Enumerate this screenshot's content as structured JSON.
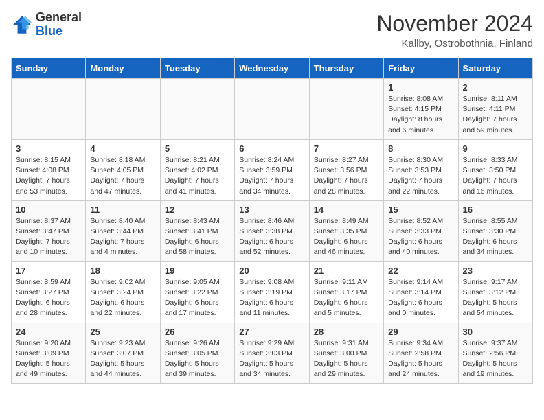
{
  "header": {
    "logo_line1": "General",
    "logo_line2": "Blue",
    "month_title": "November 2024",
    "location": "Kallby, Ostrobothnia, Finland"
  },
  "days_of_week": [
    "Sunday",
    "Monday",
    "Tuesday",
    "Wednesday",
    "Thursday",
    "Friday",
    "Saturday"
  ],
  "weeks": [
    [
      {
        "day": "",
        "info": ""
      },
      {
        "day": "",
        "info": ""
      },
      {
        "day": "",
        "info": ""
      },
      {
        "day": "",
        "info": ""
      },
      {
        "day": "",
        "info": ""
      },
      {
        "day": "1",
        "info": "Sunrise: 8:08 AM\nSunset: 4:15 PM\nDaylight: 8 hours\nand 6 minutes."
      },
      {
        "day": "2",
        "info": "Sunrise: 8:11 AM\nSunset: 4:11 PM\nDaylight: 7 hours\nand 59 minutes."
      }
    ],
    [
      {
        "day": "3",
        "info": "Sunrise: 8:15 AM\nSunset: 4:08 PM\nDaylight: 7 hours\nand 53 minutes."
      },
      {
        "day": "4",
        "info": "Sunrise: 8:18 AM\nSunset: 4:05 PM\nDaylight: 7 hours\nand 47 minutes."
      },
      {
        "day": "5",
        "info": "Sunrise: 8:21 AM\nSunset: 4:02 PM\nDaylight: 7 hours\nand 41 minutes."
      },
      {
        "day": "6",
        "info": "Sunrise: 8:24 AM\nSunset: 3:59 PM\nDaylight: 7 hours\nand 34 minutes."
      },
      {
        "day": "7",
        "info": "Sunrise: 8:27 AM\nSunset: 3:56 PM\nDaylight: 7 hours\nand 28 minutes."
      },
      {
        "day": "8",
        "info": "Sunrise: 8:30 AM\nSunset: 3:53 PM\nDaylight: 7 hours\nand 22 minutes."
      },
      {
        "day": "9",
        "info": "Sunrise: 8:33 AM\nSunset: 3:50 PM\nDaylight: 7 hours\nand 16 minutes."
      }
    ],
    [
      {
        "day": "10",
        "info": "Sunrise: 8:37 AM\nSunset: 3:47 PM\nDaylight: 7 hours\nand 10 minutes."
      },
      {
        "day": "11",
        "info": "Sunrise: 8:40 AM\nSunset: 3:44 PM\nDaylight: 7 hours\nand 4 minutes."
      },
      {
        "day": "12",
        "info": "Sunrise: 8:43 AM\nSunset: 3:41 PM\nDaylight: 6 hours\nand 58 minutes."
      },
      {
        "day": "13",
        "info": "Sunrise: 8:46 AM\nSunset: 3:38 PM\nDaylight: 6 hours\nand 52 minutes."
      },
      {
        "day": "14",
        "info": "Sunrise: 8:49 AM\nSunset: 3:35 PM\nDaylight: 6 hours\nand 46 minutes."
      },
      {
        "day": "15",
        "info": "Sunrise: 8:52 AM\nSunset: 3:33 PM\nDaylight: 6 hours\nand 40 minutes."
      },
      {
        "day": "16",
        "info": "Sunrise: 8:55 AM\nSunset: 3:30 PM\nDaylight: 6 hours\nand 34 minutes."
      }
    ],
    [
      {
        "day": "17",
        "info": "Sunrise: 8:59 AM\nSunset: 3:27 PM\nDaylight: 6 hours\nand 28 minutes."
      },
      {
        "day": "18",
        "info": "Sunrise: 9:02 AM\nSunset: 3:24 PM\nDaylight: 6 hours\nand 22 minutes."
      },
      {
        "day": "19",
        "info": "Sunrise: 9:05 AM\nSunset: 3:22 PM\nDaylight: 6 hours\nand 17 minutes."
      },
      {
        "day": "20",
        "info": "Sunrise: 9:08 AM\nSunset: 3:19 PM\nDaylight: 6 hours\nand 11 minutes."
      },
      {
        "day": "21",
        "info": "Sunrise: 9:11 AM\nSunset: 3:17 PM\nDaylight: 6 hours\nand 5 minutes."
      },
      {
        "day": "22",
        "info": "Sunrise: 9:14 AM\nSunset: 3:14 PM\nDaylight: 6 hours\nand 0 minutes."
      },
      {
        "day": "23",
        "info": "Sunrise: 9:17 AM\nSunset: 3:12 PM\nDaylight: 5 hours\nand 54 minutes."
      }
    ],
    [
      {
        "day": "24",
        "info": "Sunrise: 9:20 AM\nSunset: 3:09 PM\nDaylight: 5 hours\nand 49 minutes."
      },
      {
        "day": "25",
        "info": "Sunrise: 9:23 AM\nSunset: 3:07 PM\nDaylight: 5 hours\nand 44 minutes."
      },
      {
        "day": "26",
        "info": "Sunrise: 9:26 AM\nSunset: 3:05 PM\nDaylight: 5 hours\nand 39 minutes."
      },
      {
        "day": "27",
        "info": "Sunrise: 9:29 AM\nSunset: 3:03 PM\nDaylight: 5 hours\nand 34 minutes."
      },
      {
        "day": "28",
        "info": "Sunrise: 9:31 AM\nSunset: 3:00 PM\nDaylight: 5 hours\nand 29 minutes."
      },
      {
        "day": "29",
        "info": "Sunrise: 9:34 AM\nSunset: 2:58 PM\nDaylight: 5 hours\nand 24 minutes."
      },
      {
        "day": "30",
        "info": "Sunrise: 9:37 AM\nSunset: 2:56 PM\nDaylight: 5 hours\nand 19 minutes."
      }
    ]
  ]
}
